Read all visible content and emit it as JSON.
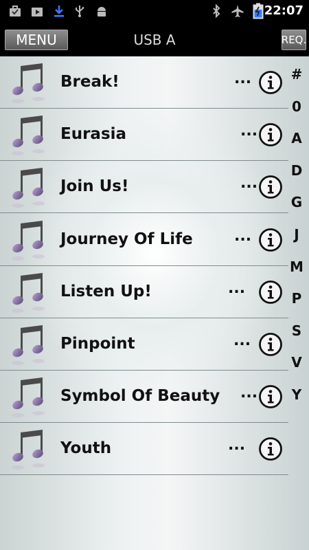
{
  "status_bar": {
    "time": "22:07",
    "left_icons": [
      "briefcase-icon",
      "youtube-icon",
      "download-icon",
      "usb-icon",
      "android-debug-icon"
    ],
    "right_icons": [
      "bluetooth-icon",
      "airplane-mode-icon",
      "battery-charging-icon"
    ]
  },
  "header": {
    "menu_label": "MENU",
    "title": "USB A",
    "req_label": "REQ."
  },
  "songs": [
    {
      "title": "Break!",
      "more": "..."
    },
    {
      "title": "Eurasia",
      "more": "..."
    },
    {
      "title": "Join Us!",
      "more": "..."
    },
    {
      "title": "Journey Of Life",
      "more": "..."
    },
    {
      "title": "Listen Up!",
      "more": "..."
    },
    {
      "title": "Pinpoint",
      "more": "..."
    },
    {
      "title": "Symbol Of Beauty",
      "more": "..."
    },
    {
      "title": "Youth",
      "more": "..."
    }
  ],
  "alpha_index": [
    "#",
    "0",
    "A",
    "D",
    "G",
    "J",
    "M",
    "P",
    "S",
    "V",
    "Y"
  ]
}
